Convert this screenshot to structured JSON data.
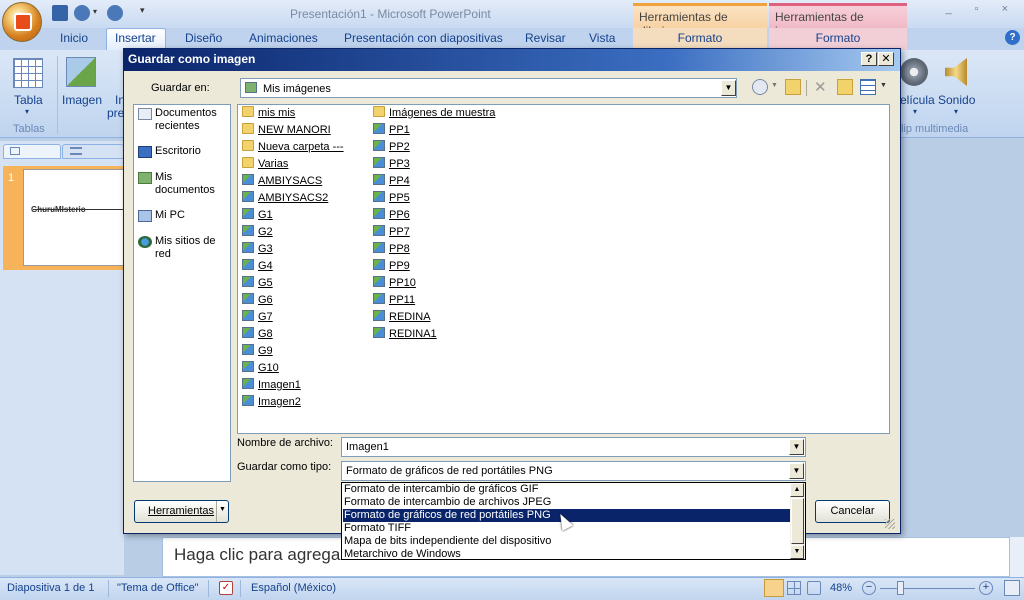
{
  "app": {
    "title": "Presentación1 - Microsoft PowerPoint",
    "context_tabs": [
      "Herramientas de dibujo",
      "Herramientas de imagen"
    ],
    "context_subtabs": [
      "Formato",
      "Formato"
    ]
  },
  "ribbon": {
    "tabs": [
      "Inicio",
      "Insertar",
      "Diseño",
      "Animaciones",
      "Presentación con diapositivas",
      "Revisar",
      "Vista"
    ],
    "active_tab": "Insertar",
    "left_buttons": [
      "Tabla",
      "Imagen",
      "In",
      "pre"
    ],
    "left_group": "Tablas",
    "right_buttons": [
      "elícula",
      "Sonido"
    ],
    "right_group": "lip multimedia"
  },
  "slide_pane": {
    "slide_number": "1",
    "thumb_text": "GhuruMIsterio"
  },
  "notes": {
    "placeholder": "Haga clic para agregar n"
  },
  "status": {
    "slide": "Diapositiva 1 de 1",
    "theme": "\"Tema de Office\"",
    "language": "Español (México)",
    "zoom": "48%"
  },
  "dialog": {
    "title": "Guardar como imagen",
    "save_in_label": "Guardar en:",
    "save_in_value": "Mis imágenes",
    "places": [
      {
        "label": "Documentos recientes",
        "icon": "recent-docs-icon"
      },
      {
        "label": "Escritorio",
        "icon": "desktop-icon"
      },
      {
        "label": "Mis documentos",
        "icon": "my-documents-icon"
      },
      {
        "label": "Mi PC",
        "icon": "my-computer-icon"
      },
      {
        "label": "Mis sitios de red",
        "icon": "network-places-icon"
      }
    ],
    "files_col1": [
      {
        "name": "mis mis",
        "type": "folder"
      },
      {
        "name": "NEW MANORI",
        "type": "folder"
      },
      {
        "name": "Nueva carpeta ---",
        "type": "folder"
      },
      {
        "name": "Varias",
        "type": "folder"
      },
      {
        "name": "AMBIYSACS",
        "type": "image"
      },
      {
        "name": "AMBIYSACS2",
        "type": "image"
      },
      {
        "name": "G1",
        "type": "image"
      },
      {
        "name": "G2",
        "type": "image"
      },
      {
        "name": "G3",
        "type": "image"
      },
      {
        "name": "G4",
        "type": "image"
      },
      {
        "name": "G5",
        "type": "image"
      },
      {
        "name": "G6",
        "type": "image"
      },
      {
        "name": "G7",
        "type": "image"
      },
      {
        "name": "G8",
        "type": "image"
      },
      {
        "name": "G9",
        "type": "image"
      },
      {
        "name": "G10",
        "type": "image"
      },
      {
        "name": "Imagen1",
        "type": "image"
      },
      {
        "name": "Imagen2",
        "type": "image"
      }
    ],
    "files_col2": [
      {
        "name": "Imágenes de muestra",
        "type": "folder"
      },
      {
        "name": "PP1",
        "type": "image"
      },
      {
        "name": "PP2",
        "type": "image"
      },
      {
        "name": "PP3",
        "type": "image"
      },
      {
        "name": "PP4",
        "type": "image"
      },
      {
        "name": "PP5",
        "type": "image"
      },
      {
        "name": "PP6",
        "type": "image"
      },
      {
        "name": "PP7",
        "type": "image"
      },
      {
        "name": "PP8",
        "type": "image"
      },
      {
        "name": "PP9",
        "type": "image"
      },
      {
        "name": "PP10",
        "type": "image"
      },
      {
        "name": "PP11",
        "type": "image"
      },
      {
        "name": "REDINA",
        "type": "image"
      },
      {
        "name": "REDINA1",
        "type": "image"
      }
    ],
    "filename_label": "Nombre de archivo:",
    "filename_value": "Imagen1",
    "filetype_label": "Guardar como tipo:",
    "filetype_value": "Formato de gráficos de red portátiles PNG",
    "filetype_options": [
      "Formato de intercambio de gráficos GIF",
      "Formato de intercambio de archivos JPEG",
      "Formato de gráficos de red portátiles PNG",
      "Formato TIFF",
      "Mapa de bits independiente del dispositivo",
      "Metarchivo de Windows"
    ],
    "selected_option_index": 2,
    "tools_button": "Herramientas",
    "cancel_button": "Cancelar"
  }
}
